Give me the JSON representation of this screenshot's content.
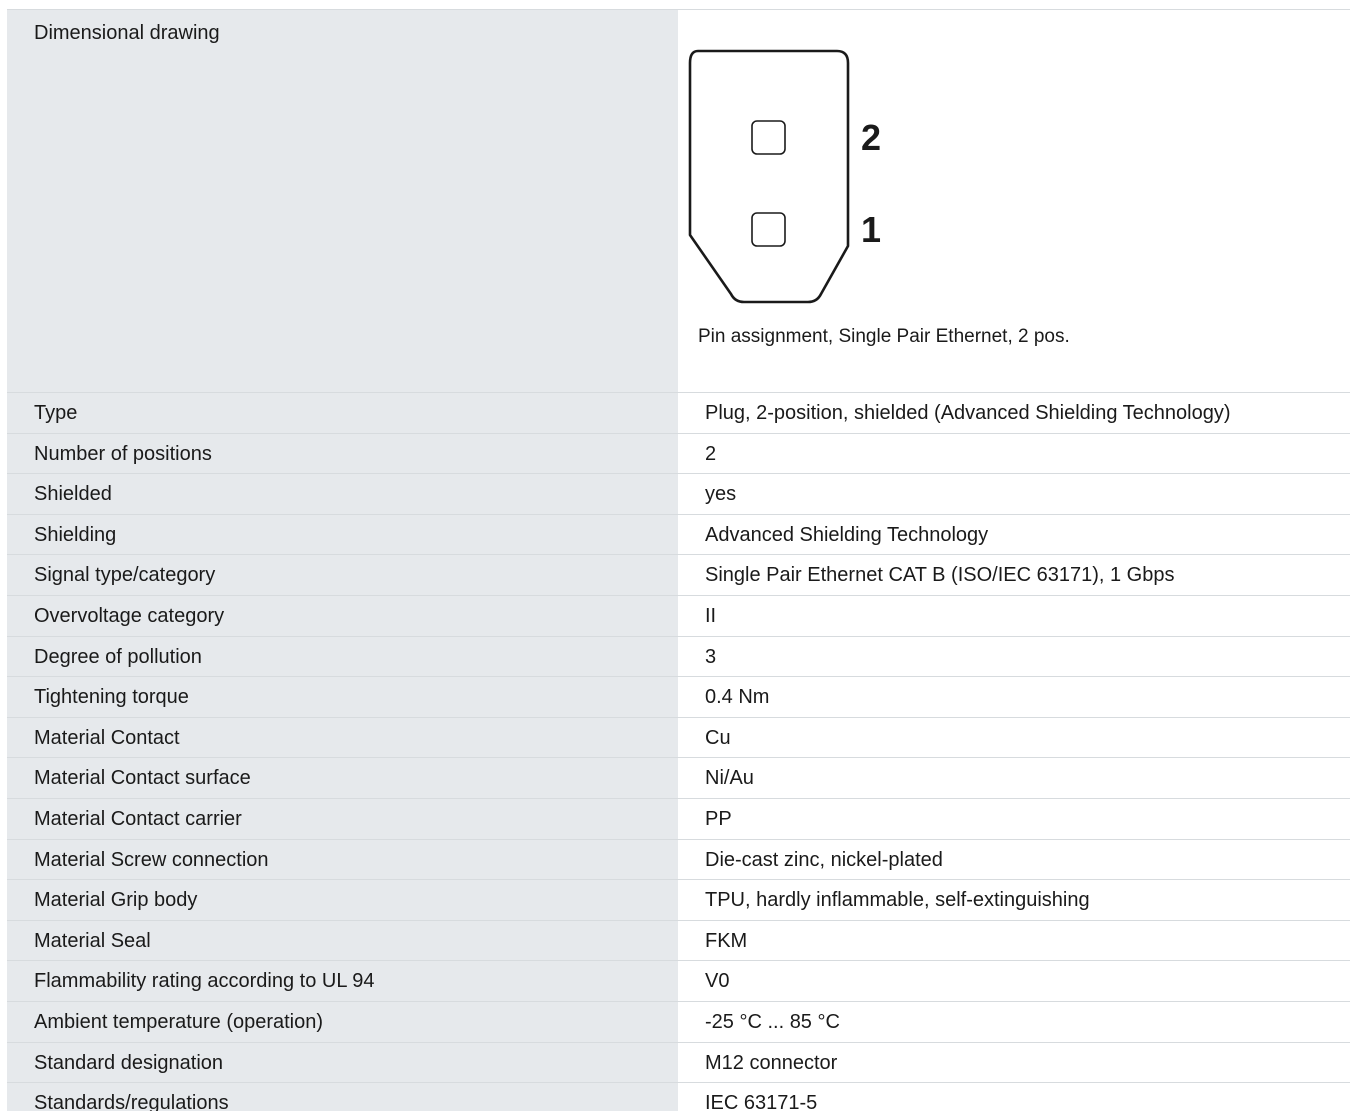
{
  "drawing": {
    "label": "Dimensional drawing",
    "pin_labels": [
      "2",
      "1"
    ],
    "caption": "Pin assignment, Single Pair Ethernet, 2 pos."
  },
  "specs": [
    {
      "label": "Type",
      "value": "Plug, 2-position, shielded (Advanced Shielding Technology)"
    },
    {
      "label": "Number of positions",
      "value": "2"
    },
    {
      "label": "Shielded",
      "value": "yes"
    },
    {
      "label": "Shielding",
      "value": "Advanced Shielding Technology"
    },
    {
      "label": "Signal type/category",
      "value": "Single Pair Ethernet CAT B (ISO/IEC 63171), 1 Gbps"
    },
    {
      "label": "Overvoltage category",
      "value": "II"
    },
    {
      "label": "Degree of pollution",
      "value": "3"
    },
    {
      "label": "Tightening torque",
      "value": "0.4 Nm"
    },
    {
      "label": "Material Contact",
      "value": "Cu"
    },
    {
      "label": "Material Contact surface",
      "value": "Ni/Au"
    },
    {
      "label": "Material Contact carrier",
      "value": "PP"
    },
    {
      "label": "Material Screw connection",
      "value": "Die-cast zinc, nickel-plated"
    },
    {
      "label": "Material Grip body",
      "value": "TPU, hardly inflammable, self-extinguishing"
    },
    {
      "label": "Material Seal",
      "value": "FKM"
    },
    {
      "label": "Flammability rating according to UL 94",
      "value": "V0"
    },
    {
      "label": "Ambient temperature (operation)",
      "value": "-25 °C ... 85 °C"
    },
    {
      "label": "Standard designation",
      "value": "M12 connector"
    },
    {
      "label": "Standards/regulations",
      "value": "IEC 63171-5"
    }
  ]
}
